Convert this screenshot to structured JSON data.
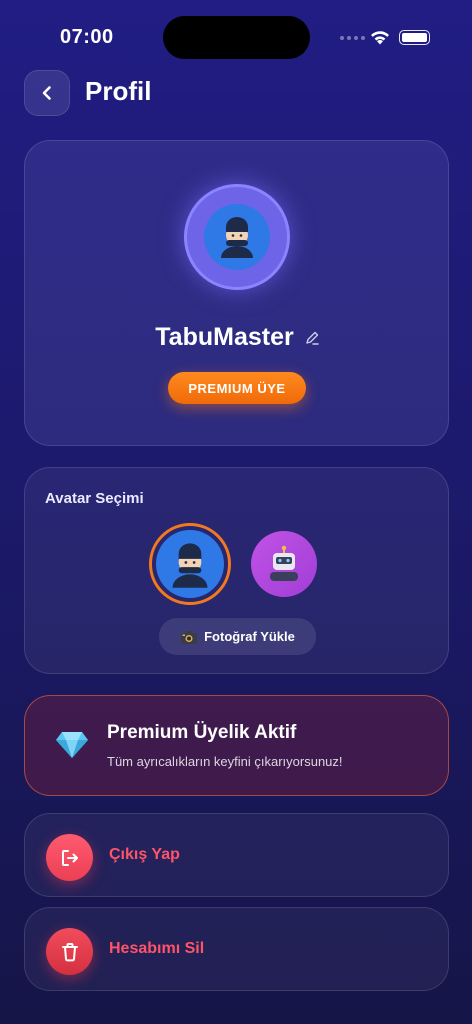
{
  "status_bar": {
    "time": "07:00"
  },
  "header": {
    "title": "Profil"
  },
  "profile": {
    "username": "TabuMaster",
    "badge": "PREMIUM ÜYE"
  },
  "avatar_selection": {
    "title": "Avatar Seçimi",
    "options": [
      {
        "icon": "ninja-avatar",
        "selected": true
      },
      {
        "icon": "robot-avatar",
        "selected": false
      }
    ],
    "upload_label": "Fotoğraf Yükle"
  },
  "premium": {
    "title": "Premium Üyelik Aktif",
    "subtitle": "Tüm ayrıcalıkların keyfini çıkarıyorsunuz!"
  },
  "actions": {
    "logout_label": "Çıkış Yap",
    "delete_label": "Hesabımı Sil"
  },
  "colors": {
    "accent_orange": "#f27a1e",
    "danger_red": "#ff5468",
    "background": "#1c1a6d"
  }
}
